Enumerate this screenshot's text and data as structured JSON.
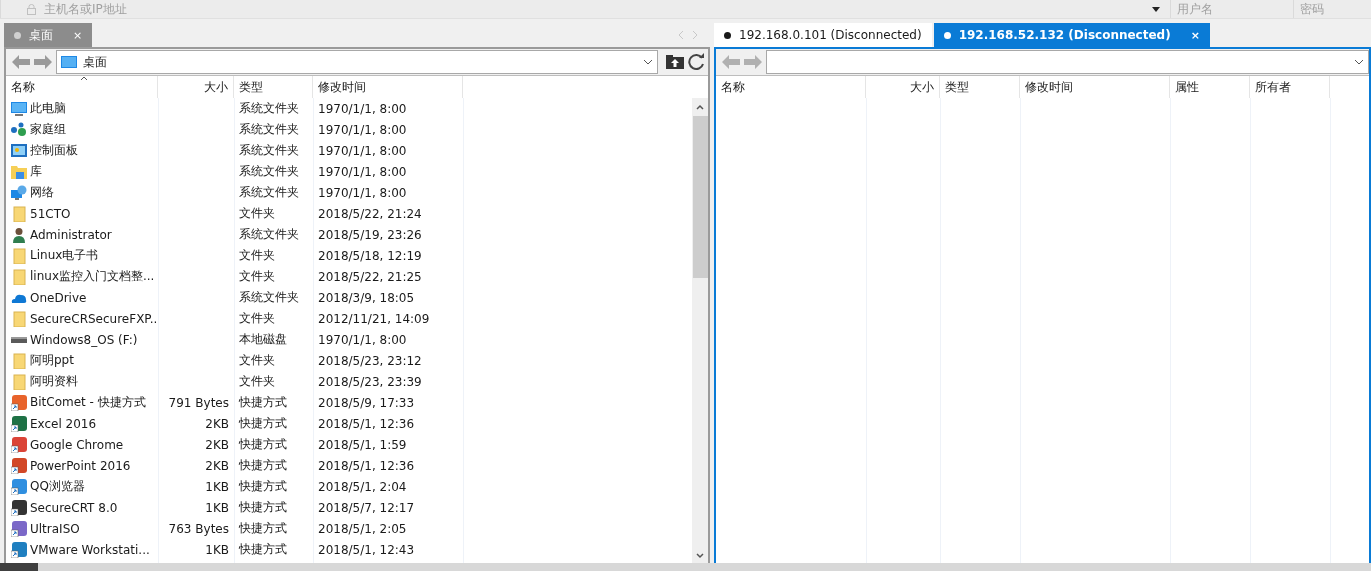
{
  "connection_bar": {
    "host_placeholder": "主机名或IP地址",
    "user_placeholder": "用户名",
    "password_placeholder": "密码"
  },
  "panels": [
    {
      "active": false,
      "tabs": [
        {
          "label": "桌面",
          "selected": true,
          "close": "×"
        }
      ],
      "path": "桌面",
      "columns": [
        "名称",
        "大小",
        "类型",
        "修改时间"
      ],
      "rows": [
        {
          "kind": "computer",
          "name": "此电脑",
          "size": "",
          "type": "系统文件夹",
          "modified": "1970/1/1, 8:00"
        },
        {
          "kind": "homegroup",
          "name": "家庭组",
          "size": "",
          "type": "系统文件夹",
          "modified": "1970/1/1, 8:00"
        },
        {
          "kind": "control-panel",
          "name": "控制面板",
          "size": "",
          "type": "系统文件夹",
          "modified": "1970/1/1, 8:00"
        },
        {
          "kind": "library",
          "name": "库",
          "size": "",
          "type": "系统文件夹",
          "modified": "1970/1/1, 8:00"
        },
        {
          "kind": "network",
          "name": "网络",
          "size": "",
          "type": "系统文件夹",
          "modified": "1970/1/1, 8:00"
        },
        {
          "kind": "folder",
          "name": "51CTO",
          "size": "",
          "type": "文件夹",
          "modified": "2018/5/22, 21:24"
        },
        {
          "kind": "user",
          "name": "Administrator",
          "size": "",
          "type": "系统文件夹",
          "modified": "2018/5/19, 23:26"
        },
        {
          "kind": "folder",
          "name": "Linux电子书",
          "size": "",
          "type": "文件夹",
          "modified": "2018/5/18, 12:19"
        },
        {
          "kind": "folder",
          "name": "linux监控入门文档整...",
          "size": "",
          "type": "文件夹",
          "modified": "2018/5/22, 21:25"
        },
        {
          "kind": "cloud",
          "name": "OneDrive",
          "size": "",
          "type": "系统文件夹",
          "modified": "2018/3/9, 18:05"
        },
        {
          "kind": "folder",
          "name": "SecureCRSecureFXP...",
          "size": "",
          "type": "文件夹",
          "modified": "2012/11/21, 14:09"
        },
        {
          "kind": "drive",
          "name": "Windows8_OS (F:)",
          "size": "",
          "type": "本地磁盘",
          "modified": "1970/1/1, 8:00"
        },
        {
          "kind": "folder",
          "name": "阿明ppt",
          "size": "",
          "type": "文件夹",
          "modified": "2018/5/23, 23:12"
        },
        {
          "kind": "folder",
          "name": "阿明资料",
          "size": "",
          "type": "文件夹",
          "modified": "2018/5/23, 23:39"
        },
        {
          "kind": "shortcut",
          "color": "#e8632b",
          "name": "BitComet - 快捷方式",
          "size": "791 Bytes",
          "type": "快捷方式",
          "modified": "2018/5/9, 17:33"
        },
        {
          "kind": "shortcut",
          "color": "#1e7145",
          "name": "Excel 2016",
          "size": "2KB",
          "type": "快捷方式",
          "modified": "2018/5/1, 12:36"
        },
        {
          "kind": "shortcut",
          "color": "#db4437",
          "name": "Google Chrome",
          "size": "2KB",
          "type": "快捷方式",
          "modified": "2018/5/1, 1:59"
        },
        {
          "kind": "shortcut",
          "color": "#d24726",
          "name": "PowerPoint 2016",
          "size": "2KB",
          "type": "快捷方式",
          "modified": "2018/5/1, 12:36"
        },
        {
          "kind": "shortcut",
          "color": "#2f8fe0",
          "name": "QQ浏览器",
          "size": "1KB",
          "type": "快捷方式",
          "modified": "2018/5/1, 2:04"
        },
        {
          "kind": "shortcut",
          "color": "#333333",
          "name": "SecureCRT 8.0",
          "size": "1KB",
          "type": "快捷方式",
          "modified": "2018/5/7, 12:17"
        },
        {
          "kind": "shortcut",
          "color": "#7b68c8",
          "name": "UltraISO",
          "size": "763 Bytes",
          "type": "快捷方式",
          "modified": "2018/5/1, 2:05"
        },
        {
          "kind": "shortcut",
          "color": "#1f7fc0",
          "name": "VMware Workstati...",
          "size": "1KB",
          "type": "快捷方式",
          "modified": "2018/5/1, 12:43"
        }
      ]
    },
    {
      "active": true,
      "tabs": [
        {
          "label": "192.168.0.101 (Disconnected)",
          "selected": false
        },
        {
          "label": "192.168.52.132 (Disconnected)",
          "selected": true,
          "close": "×"
        }
      ],
      "columns": [
        "名称",
        "大小",
        "类型",
        "修改时间",
        "属性",
        "所有者"
      ]
    }
  ]
}
